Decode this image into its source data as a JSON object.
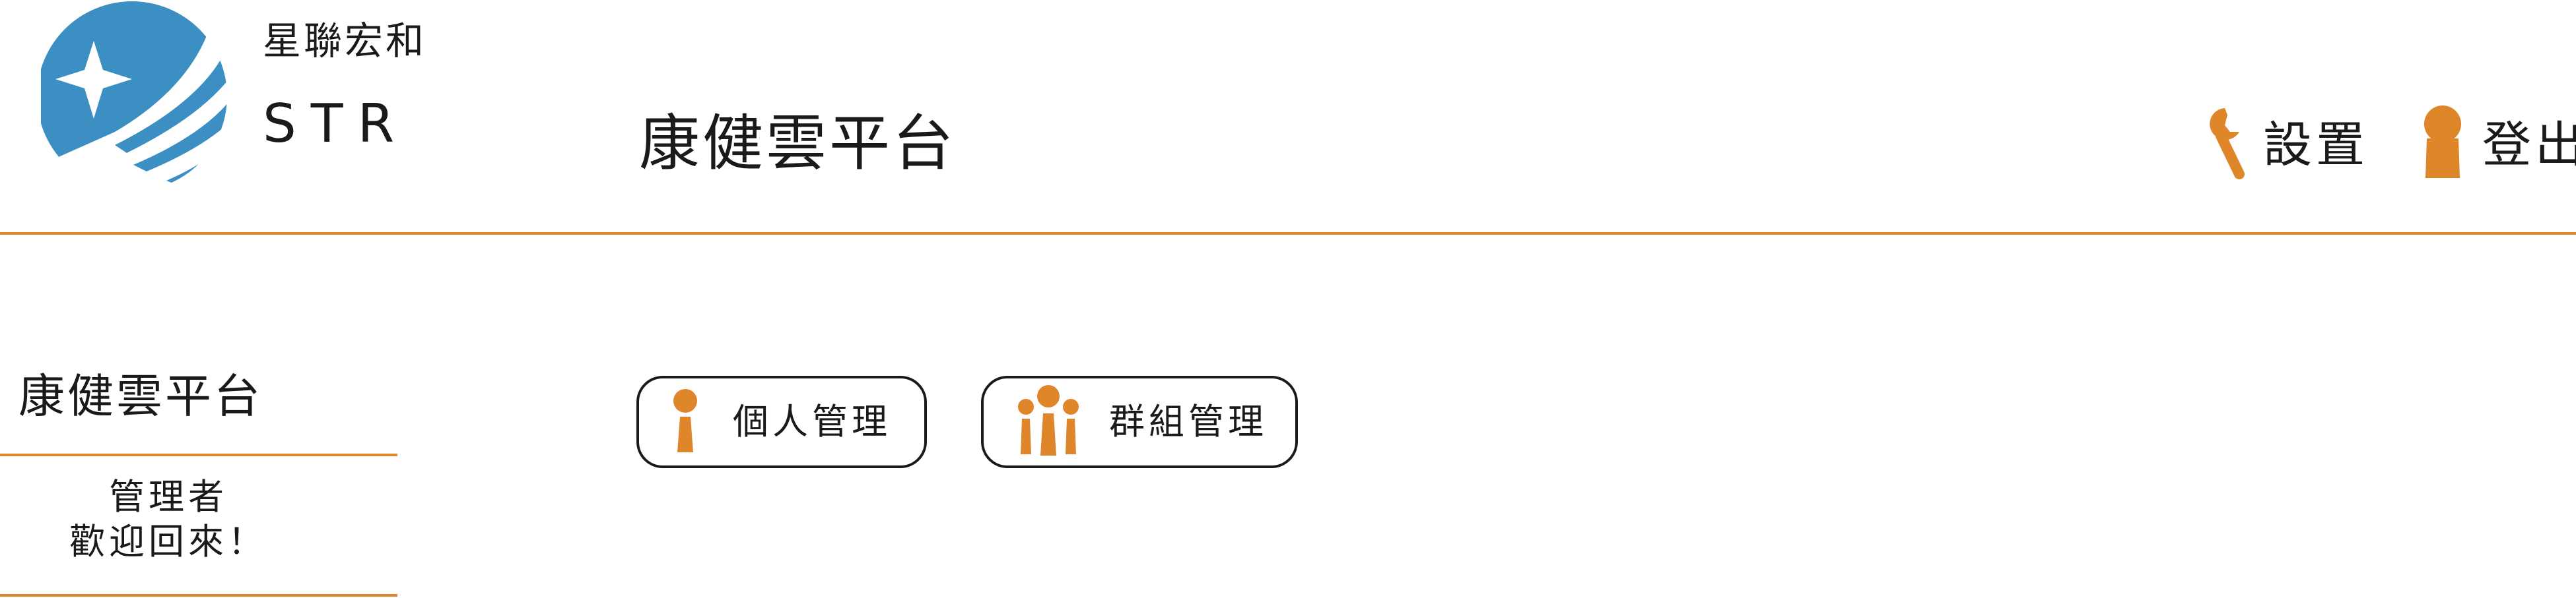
{
  "brand": {
    "name_cn": "星聯宏和",
    "name_en": "STR",
    "logo_icon": "star-sphere-icon",
    "color": "#3b8fc3"
  },
  "header": {
    "title": "康健雲平台",
    "settings": {
      "label": "設置",
      "icon": "wrench-icon"
    },
    "logout": {
      "label": "登出",
      "icon": "user-icon"
    },
    "accent_color": "#e0862a"
  },
  "sidebar": {
    "title": "康健雲平台",
    "welcome_role": "管理者",
    "welcome_message": "歡迎回來！"
  },
  "main": {
    "tiles": [
      {
        "label": "個人管理",
        "icon": "person-icon"
      },
      {
        "label": "群組管理",
        "icon": "group-icon"
      }
    ]
  }
}
